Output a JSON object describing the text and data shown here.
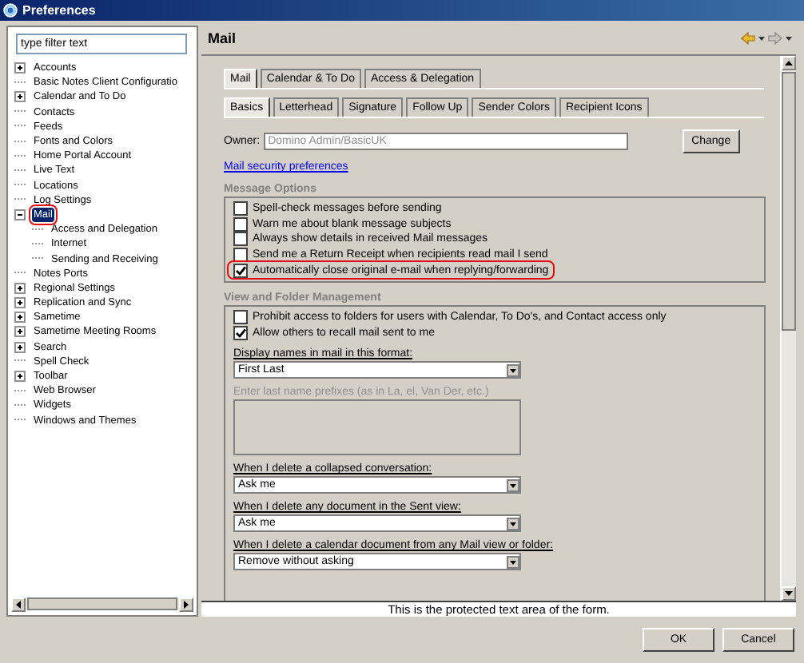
{
  "window": {
    "title": "Preferences"
  },
  "filter": {
    "placeholder": "type filter text"
  },
  "tree": [
    {
      "label": "Accounts",
      "expanded": false
    },
    {
      "label": "Basic Notes Client Configuratio"
    },
    {
      "label": "Calendar and To Do",
      "expanded": false
    },
    {
      "label": "Contacts"
    },
    {
      "label": "Feeds"
    },
    {
      "label": "Fonts and Colors"
    },
    {
      "label": "Home Portal Account"
    },
    {
      "label": "Live Text"
    },
    {
      "label": "Locations"
    },
    {
      "label": "Log Settings"
    },
    {
      "label": "Mail",
      "expanded": true,
      "selected": true,
      "highlighted": true,
      "children": [
        {
          "label": "Access and Delegation"
        },
        {
          "label": "Internet"
        },
        {
          "label": "Sending and Receiving"
        }
      ]
    },
    {
      "label": "Notes Ports"
    },
    {
      "label": "Regional Settings",
      "expanded": false
    },
    {
      "label": "Replication and Sync",
      "expanded": false
    },
    {
      "label": "Sametime",
      "expanded": false
    },
    {
      "label": "Sametime Meeting Rooms",
      "expanded": false
    },
    {
      "label": "Search",
      "expanded": false
    },
    {
      "label": "Spell Check"
    },
    {
      "label": "Toolbar",
      "expanded": false
    },
    {
      "label": "Web Browser"
    },
    {
      "label": "Widgets"
    },
    {
      "label": "Windows and Themes"
    }
  ],
  "page": {
    "title": "Mail",
    "tabs": [
      {
        "label": "Mail",
        "selected": true
      },
      {
        "label": "Calendar & To Do",
        "selected": false
      },
      {
        "label": "Access & Delegation",
        "selected": false
      }
    ],
    "subtabs": [
      {
        "label": "Basics",
        "selected": true
      },
      {
        "label": "Letterhead",
        "selected": false
      },
      {
        "label": "Signature",
        "selected": false
      },
      {
        "label": "Follow Up",
        "selected": false
      },
      {
        "label": "Sender Colors",
        "selected": false
      },
      {
        "label": "Recipient Icons",
        "selected": false
      }
    ],
    "owner": {
      "label": "Owner:",
      "value": "Domino Admin/BasicUK",
      "disabled": true,
      "button": "Change"
    },
    "link": "Mail security preferences",
    "message_options": {
      "title": "Message Options",
      "options": [
        {
          "label": "Spell-check messages before sending",
          "checked": false
        },
        {
          "label": "Warn me about blank message subjects",
          "checked": false
        },
        {
          "label": "Always show details in received Mail messages",
          "checked": false
        },
        {
          "label": "Send me a Return Receipt when recipients read mail I send",
          "checked": false
        },
        {
          "label": "Automatically close original e-mail when replying/forwarding",
          "checked": true,
          "highlighted": true
        }
      ]
    },
    "view_folder": {
      "title": "View and Folder Management",
      "options": [
        {
          "label": "Prohibit access to folders for users with Calendar, To Do's, and Contact access only",
          "checked": false
        },
        {
          "label": "Allow others to recall mail sent to me",
          "checked": true
        }
      ],
      "fields": [
        {
          "kind": "select",
          "label": "Display names in mail in this format:",
          "value": "First Last"
        },
        {
          "kind": "textarea",
          "label": "Enter last name prefixes (as in La, el, Van Der, etc.)",
          "disabled": true
        },
        {
          "kind": "select",
          "label": "When I delete a collapsed conversation:",
          "value": "Ask me"
        },
        {
          "kind": "select",
          "label": "When I delete any document in the Sent view:",
          "value": "Ask me"
        },
        {
          "kind": "select",
          "label": "When I delete a calendar document from any Mail view or folder:",
          "value": "Remove without asking"
        }
      ]
    }
  },
  "protected_text": "This is the protected text area of the form.",
  "buttons": [
    "OK",
    "Cancel"
  ]
}
